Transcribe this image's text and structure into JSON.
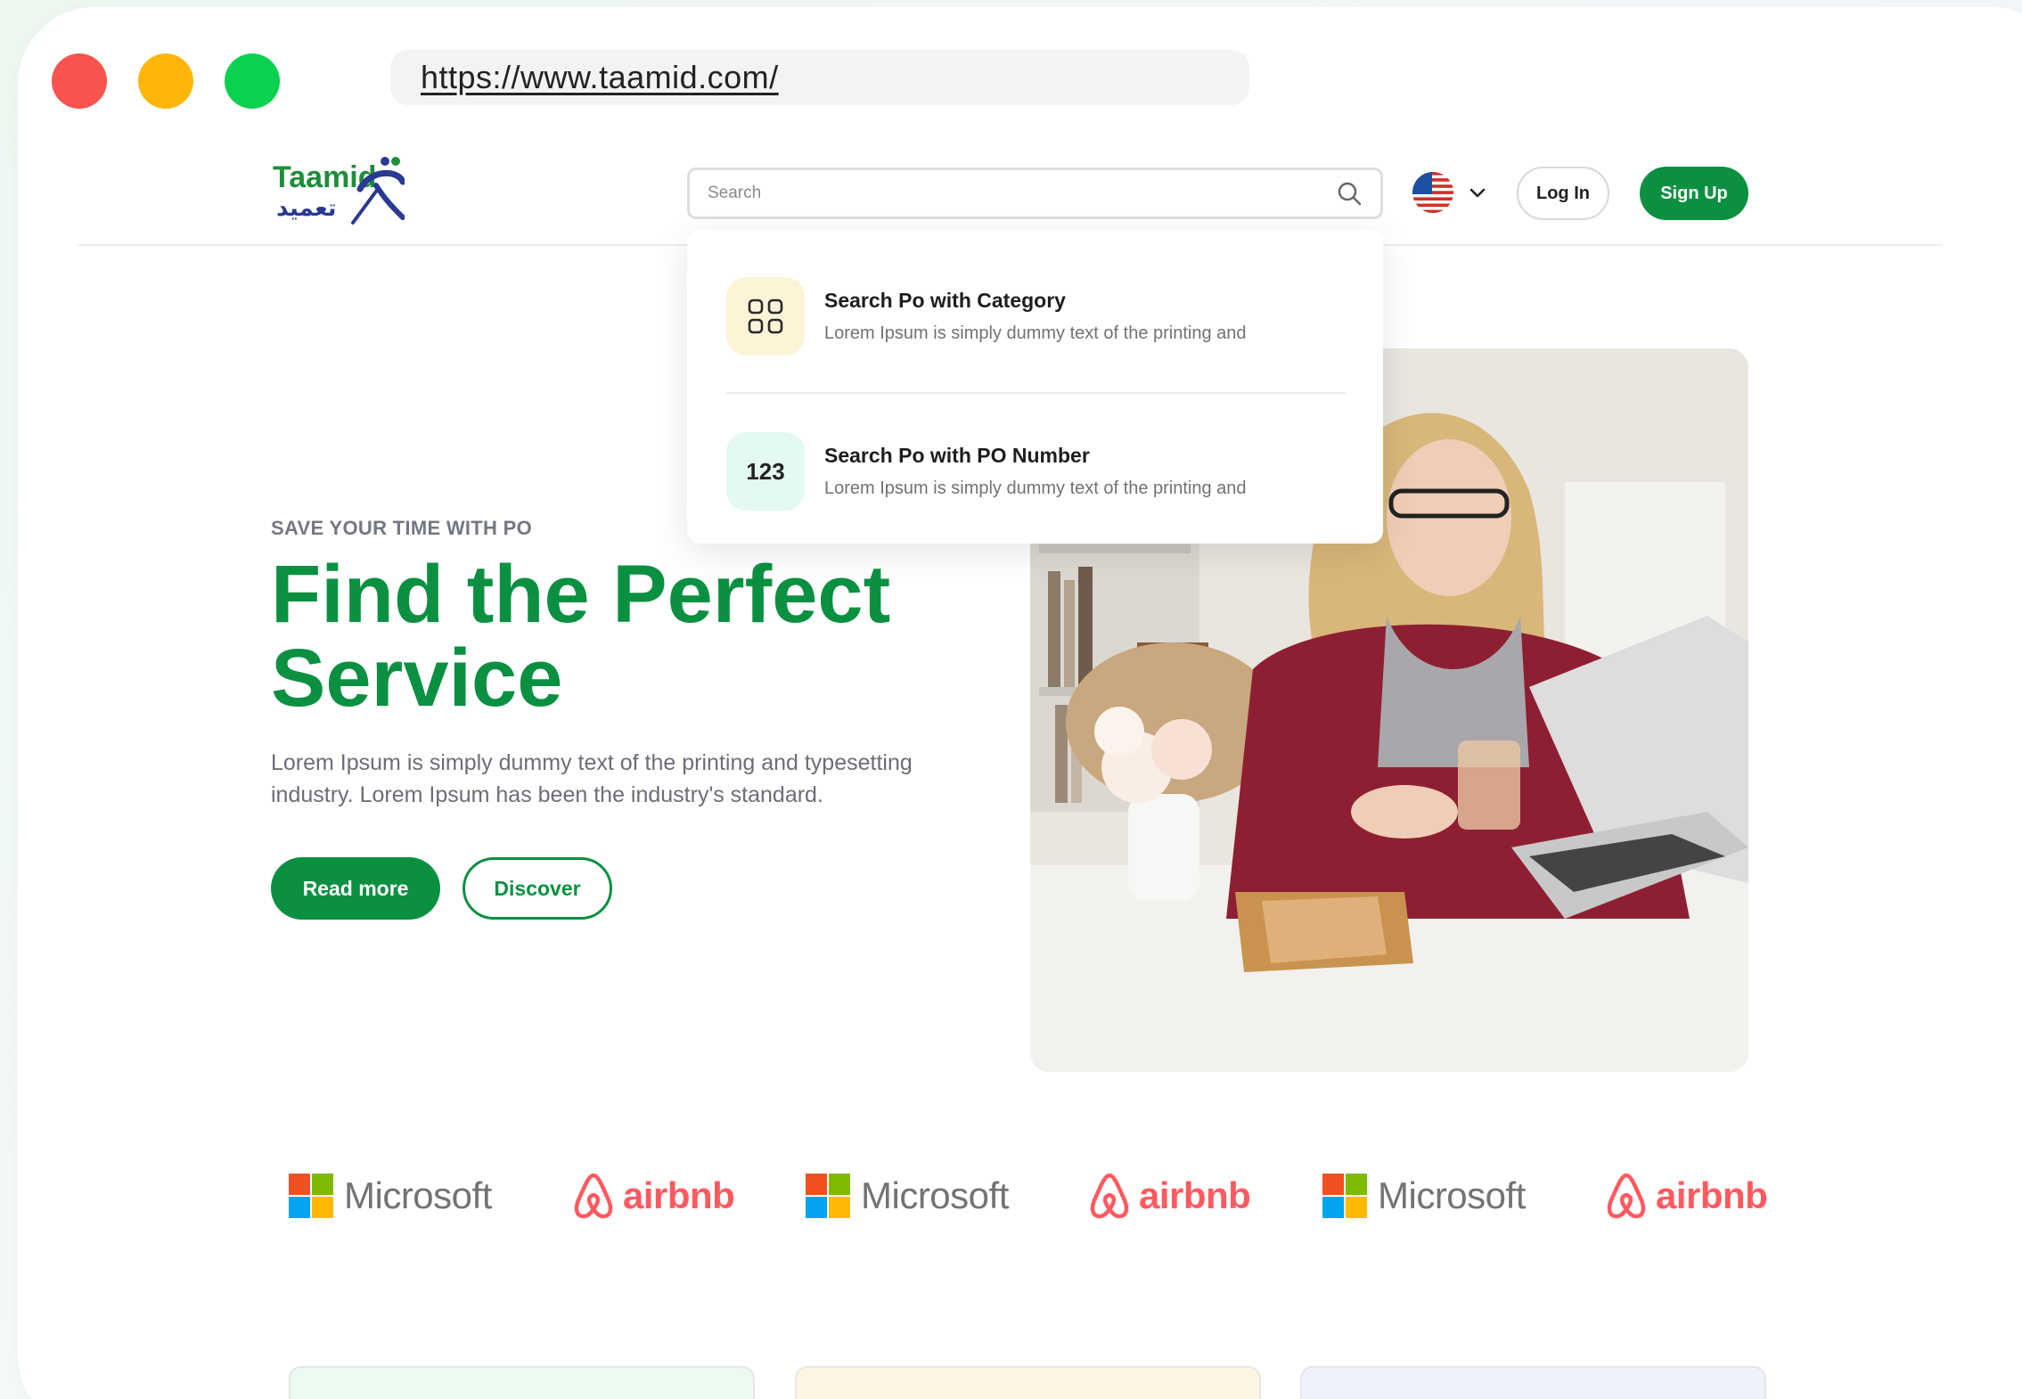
{
  "browser": {
    "url": "https://www.taamid.com/"
  },
  "brand": {
    "logo_text": "Taamid",
    "logo_arabic": "تعميد",
    "accent": "#0b9042"
  },
  "nav": {
    "search_placeholder": "Search",
    "language_icon": "us-flag-icon",
    "login_label": "Log In",
    "signup_label": "Sign Up"
  },
  "dropdown": {
    "items": [
      {
        "icon": "grid-icon",
        "title": "Search Po with Category",
        "description": "Lorem Ipsum is simply dummy text of the printing and"
      },
      {
        "icon_text": "123",
        "title": "Search Po with PO Number",
        "description": "Lorem Ipsum is simply dummy text of the printing and"
      }
    ]
  },
  "hero": {
    "eyebrow": "SAVE YOUR TIME WITH PO",
    "title_line1": "Find the Perfect",
    "title_line2": "Service",
    "description": "Lorem Ipsum is simply dummy text of the printing and typesetting industry. Lorem Ipsum has been the industry's standard.",
    "read_more_label": "Read more",
    "discover_label": "Discover"
  },
  "partners": [
    {
      "type": "microsoft",
      "name": "Microsoft"
    },
    {
      "type": "airbnb",
      "name": "airbnb"
    },
    {
      "type": "microsoft",
      "name": "Microsoft"
    },
    {
      "type": "airbnb",
      "name": "airbnb"
    },
    {
      "type": "microsoft",
      "name": "Microsoft"
    },
    {
      "type": "airbnb",
      "name": "airbnb"
    }
  ]
}
